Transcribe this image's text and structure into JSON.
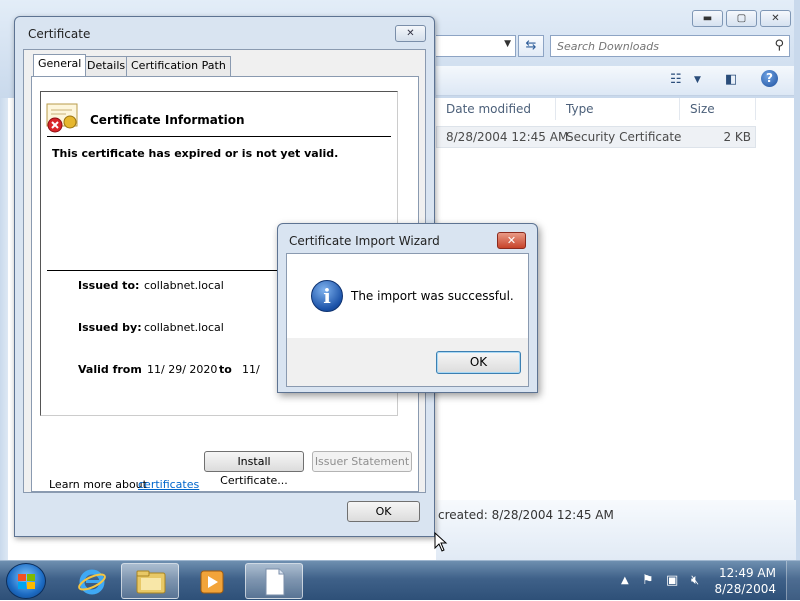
{
  "explorer": {
    "search_placeholder": "Search Downloads",
    "columns": [
      "Date modified",
      "Type",
      "Size"
    ],
    "file": {
      "date_modified": "8/28/2004 12:45 AM",
      "type": "Security Certificate",
      "size": "2 KB"
    },
    "details_created": "created: 8/28/2004 12:45 AM"
  },
  "certificate": {
    "title": "Certificate",
    "tabs": [
      "General",
      "Details",
      "Certification Path"
    ],
    "info_header": "Certificate Information",
    "status": "This certificate has expired or is not yet valid.",
    "issued_to_label": "Issued to:",
    "issued_to": "collabnet.local",
    "issued_by_label": "Issued by:",
    "issued_by": "collabnet.local",
    "valid_from_label": "Valid from",
    "valid_from": "11/ 29/ 2020",
    "to_label": "to",
    "valid_to_partial": "11/",
    "install_button": "Install Certificate...",
    "issuer_button": "Issuer Statement",
    "learn_more": "Learn more about",
    "learn_link": "certificates",
    "ok_button": "OK"
  },
  "wizard": {
    "title": "Certificate Import Wizard",
    "message": "The import was successful.",
    "ok_button": "OK"
  },
  "taskbar": {
    "time": "12:49 AM",
    "date": "8/28/2004"
  },
  "colors": {
    "window_frame": "#d9e4f1",
    "link": "#0066cc",
    "taskbar": "#3f6189"
  }
}
